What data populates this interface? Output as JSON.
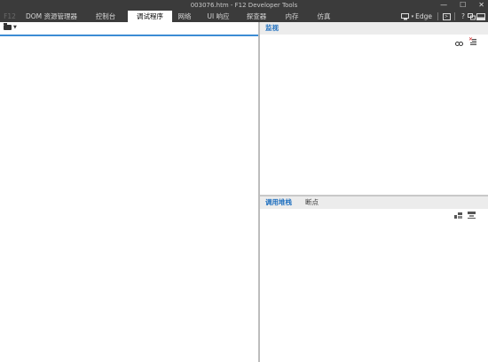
{
  "window": {
    "title": "003076.htm - F12 Developer Tools",
    "controls": [
      "—",
      "☐",
      "✕"
    ]
  },
  "tabs": [
    {
      "label": "F12",
      "state": "disabled"
    },
    {
      "label": "DOM 资源管理器",
      "state": "normal"
    },
    {
      "label": "控制台",
      "state": "normal"
    },
    {
      "label": "调试程序",
      "state": "active"
    },
    {
      "label": "网络",
      "state": "normal"
    },
    {
      "label": "UI 响应",
      "state": "normal"
    },
    {
      "label": "探查器",
      "state": "normal"
    },
    {
      "label": "内存",
      "state": "normal"
    },
    {
      "label": "仿真",
      "state": "normal"
    }
  ],
  "toolbar_right": {
    "edge_label": "Edge",
    "help_label": "?"
  },
  "watch_pane": {
    "header": "监视"
  },
  "callstack_pane": {
    "tab_callstack": "调用堆栈",
    "tab_breakpoints": "断点"
  },
  "colors": {
    "chrome_dark": "#3b3b3b",
    "accent_blue": "#1e6fbf",
    "pane_header_bg": "#ececec"
  }
}
